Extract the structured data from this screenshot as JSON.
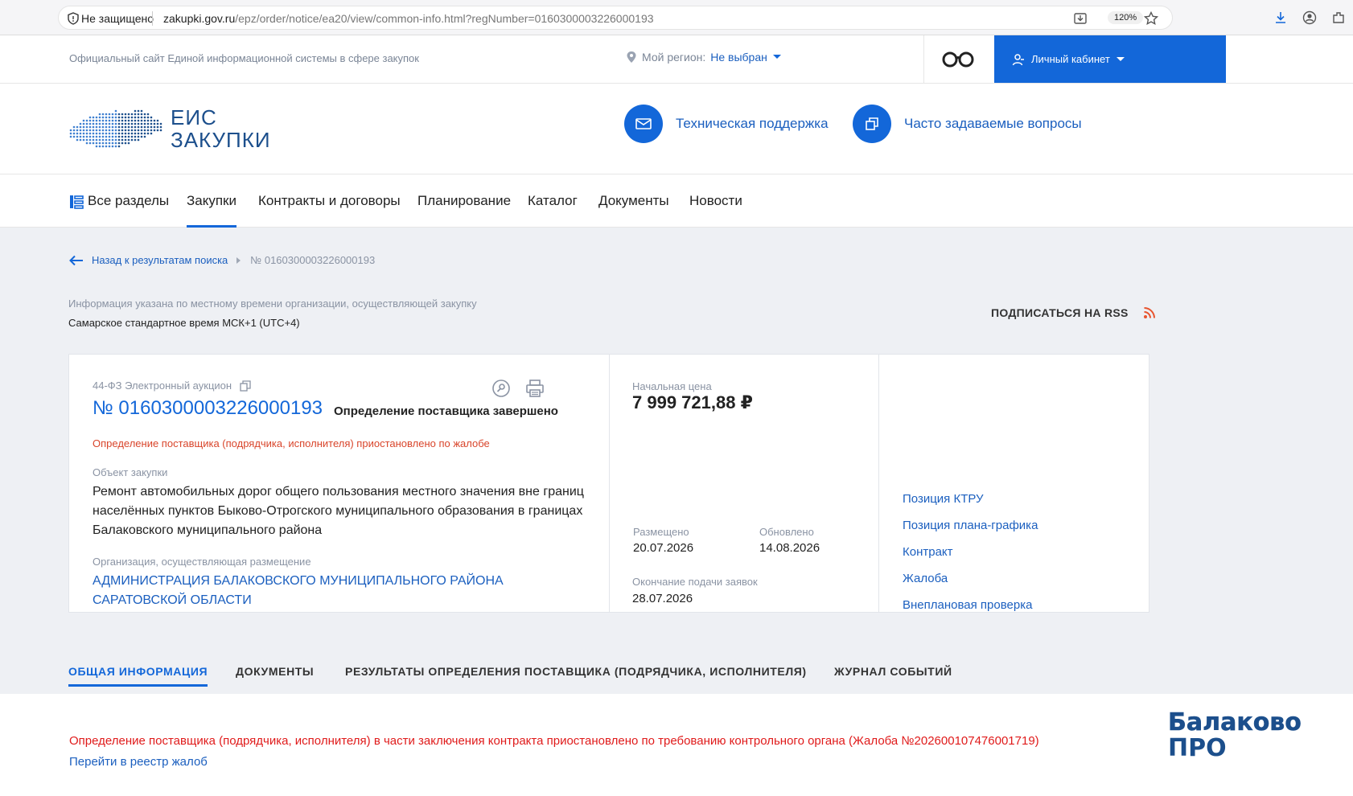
{
  "browser": {
    "insecure_label": "Не защищено",
    "url_host": "zakupki.gov.ru",
    "url_path": "/epz/order/notice/ea20/view/common-info.html?regNumber=0160300003226000193",
    "zoom": "120%"
  },
  "header": {
    "site_description": "Официальный сайт Единой информационной системы в сфере закупок",
    "region_label": "Мой регион:",
    "region_value": "Не выбран",
    "cabinet_label": "Личный кабинет"
  },
  "logo": {
    "line1": "ЕИС",
    "line2": "ЗАКУПКИ"
  },
  "links": {
    "support": "Техническая поддержка",
    "faq": "Часто задаваемые вопросы"
  },
  "nav": {
    "items": [
      "Все разделы",
      "Закупки",
      "Контракты и договоры",
      "Планирование",
      "Каталог",
      "Документы",
      "Новости"
    ]
  },
  "breadcrumb": {
    "back": "Назад к результатам поиска",
    "current": "№ 0160300003226000193"
  },
  "notice": {
    "info_note": "Информация указана по местному времени организации, осуществляющей закупку",
    "timezone": "Самарское стандартное время МСК+1 (UTC+4)",
    "rss": "ПОДПИСАТЬСЯ НА RSS"
  },
  "card": {
    "law": "44-ФЗ Электронный аукцион",
    "number": "№ 0160300003226000193",
    "status": "Определение поставщика завершено",
    "suspended": "Определение поставщика (подрядчика, исполнителя) приостановлено по жалобе",
    "object_label": "Объект закупки",
    "object_value": "Ремонт автомобильных дорог общего пользования местного значения вне границ населённых пунктов Быково-Отрогского муниципального образования в границах Балаковского муниципального района",
    "org_label": "Организация, осуществляющая размещение",
    "org_value": "АДМИНИСТРАЦИЯ БАЛАКОВСКОГО МУНИЦИПАЛЬНОГО РАЙОНА САРАТОВСКОЙ ОБЛАСТИ",
    "price_label": "Начальная цена",
    "price_value": "7 999 721,88 ₽",
    "posted_label": "Размещено",
    "posted_value": "20.07.2026",
    "updated_label": "Обновлено",
    "updated_value": "14.08.2026",
    "deadline_label": "Окончание подачи заявок",
    "deadline_value": "28.07.2026",
    "side_links": [
      "Позиция КТРУ",
      "Позиция плана-графика",
      "Контракт",
      "Жалоба",
      "Внеплановая проверка"
    ]
  },
  "tabs": [
    "ОБЩАЯ ИНФОРМАЦИЯ",
    "ДОКУМЕНТЫ",
    "РЕЗУЛЬТАТЫ ОПРЕДЕЛЕНИЯ ПОСТАВЩИКА (ПОДРЯДЧИКА, ИСПОЛНИТЕЛЯ)",
    "ЖУРНАЛ СОБЫТИЙ"
  ],
  "bottom": {
    "warning": "Определение поставщика (подрядчика, исполнителя) в части заключения контракта приостановлено по требованию контрольного органа (Жалоба №202600107476001719)",
    "registry_link": "Перейти в реестр жалоб"
  },
  "watermark": {
    "line1": "Балаково",
    "line2": "ПРО"
  },
  "colors": {
    "accent": "#1367d9",
    "link": "#1b5fbf",
    "warning": "#e01b1b",
    "muted": "#8a93a3"
  }
}
